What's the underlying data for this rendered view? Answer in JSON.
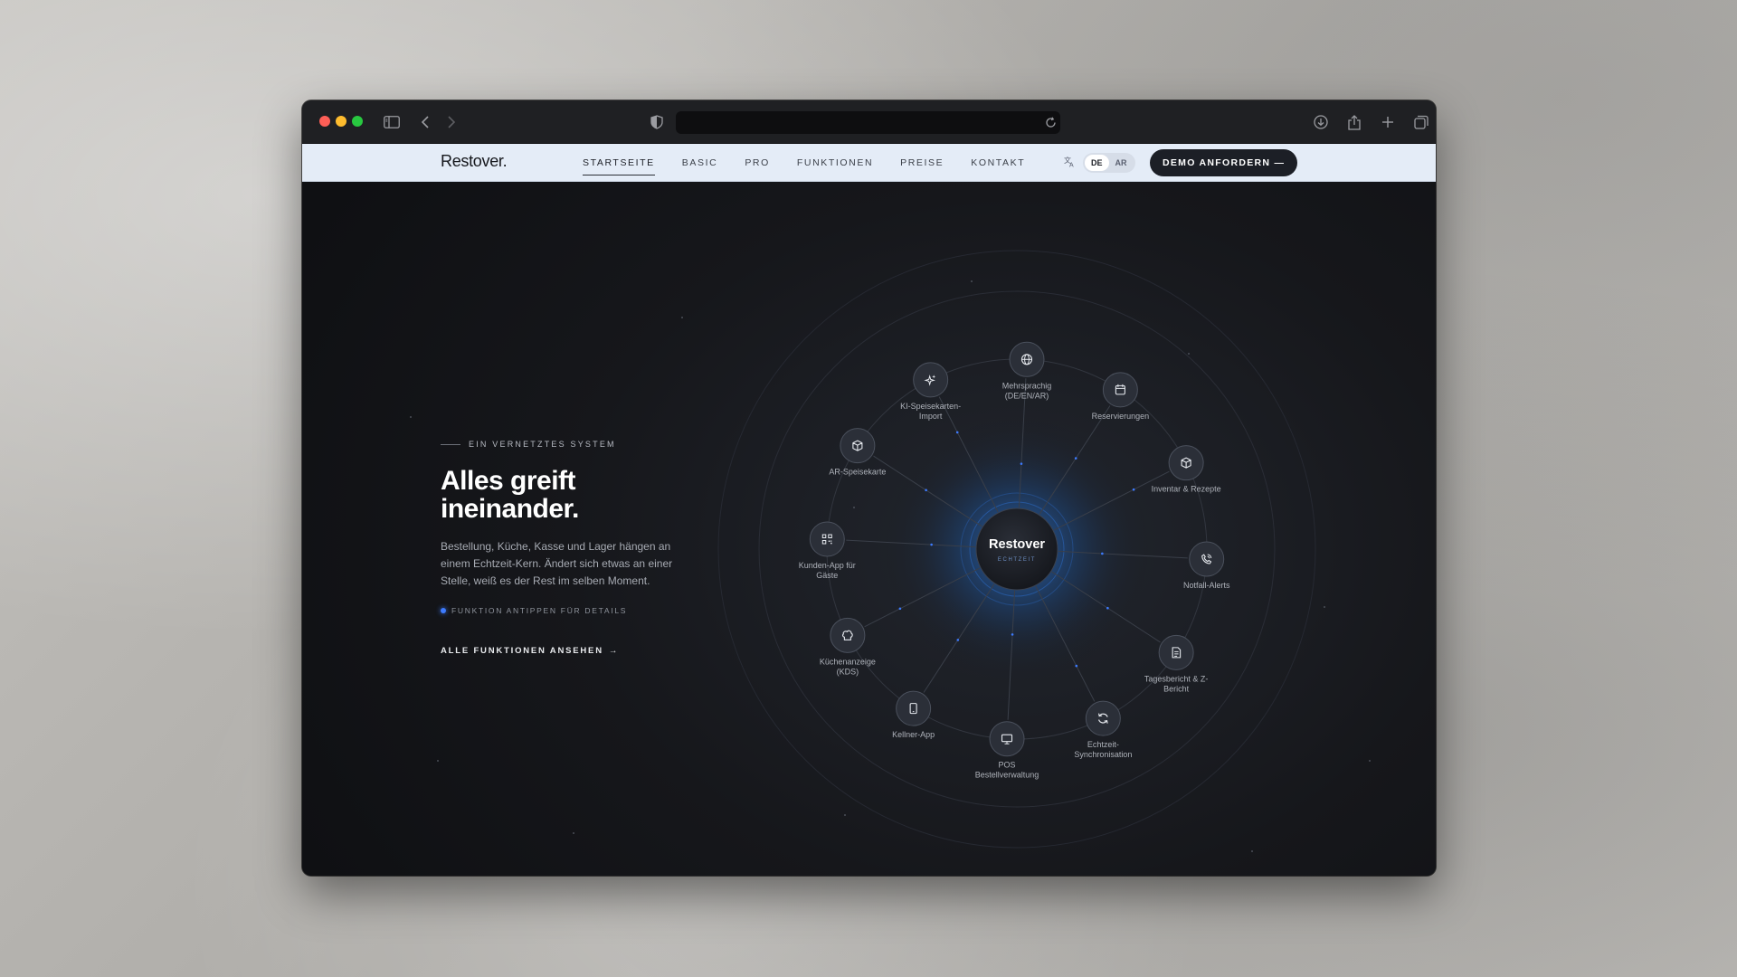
{
  "browser": {
    "url": "",
    "icons": [
      "sidebar-icon",
      "back-icon",
      "forward-icon",
      "shield-icon",
      "reload-icon",
      "download-icon",
      "share-icon",
      "new-tab-icon",
      "tabs-overview-icon"
    ]
  },
  "nav": {
    "brand": "Restover.",
    "links": [
      "STARTSEITE",
      "BASIC",
      "PRO",
      "FUNKTIONEN",
      "PREISE",
      "KONTAKT"
    ],
    "active_link": "STARTSEITE",
    "lang_options": [
      "DE",
      "AR"
    ],
    "lang_selected": "DE",
    "cta_label": "DEMO ANFORDERN —"
  },
  "hero": {
    "eyebrow": "EIN VERNETZTES SYSTEM",
    "headline_line1": "Alles greift",
    "headline_line2": "ineinander.",
    "lead": "Bestellung, Küche, Kasse und Lager hängen an einem Echtzeit-Kern. Ändert sich etwas an einer Stelle, weiß es der Rest im selben Moment.",
    "hint": "FUNKTION ANTIPPEN FÜR DETAILS",
    "all_link": "ALLE FUNKTIONEN ANSEHEN"
  },
  "diagram": {
    "core_title": "Restover",
    "core_subtitle": "ECHTZEIT",
    "accent_color": "#3d7bff",
    "nodes": [
      {
        "id": "mehrsprachig",
        "icon": "globe-icon",
        "label_lines": [
          "Mehrsprachig",
          "(DE/EN/AR)"
        ]
      },
      {
        "id": "reservierungen",
        "icon": "calendar-icon",
        "label_lines": [
          "Reservierungen"
        ]
      },
      {
        "id": "inventar",
        "icon": "box-icon",
        "label_lines": [
          "Inventar & Rezepte"
        ]
      },
      {
        "id": "notfall",
        "icon": "phone-alert-icon",
        "label_lines": [
          "Notfall-Alerts"
        ]
      },
      {
        "id": "tagesbericht",
        "icon": "document-icon",
        "label_lines": [
          "Tagesbericht & Z-",
          "Bericht"
        ]
      },
      {
        "id": "sync",
        "icon": "refresh-icon",
        "label_lines": [
          "Echtzeit-",
          "Synchronisation"
        ]
      },
      {
        "id": "pos",
        "icon": "monitor-icon",
        "label_lines": [
          "POS",
          "Bestellverwaltung"
        ]
      },
      {
        "id": "kellner",
        "icon": "tablet-icon",
        "label_lines": [
          "Kellner-App"
        ]
      },
      {
        "id": "kds",
        "icon": "chef-hat-icon",
        "label_lines": [
          "Küchenanzeige",
          "(KDS)"
        ]
      },
      {
        "id": "kunden",
        "icon": "qr-code-icon",
        "label_lines": [
          "Kunden-App für",
          "Gäste"
        ]
      },
      {
        "id": "ar",
        "icon": "cube-icon",
        "label_lines": [
          "AR-Speisekarte"
        ]
      },
      {
        "id": "ki",
        "icon": "sparkle-icon",
        "label_lines": [
          "KI-Speisekarten-",
          "Import"
        ]
      }
    ]
  }
}
